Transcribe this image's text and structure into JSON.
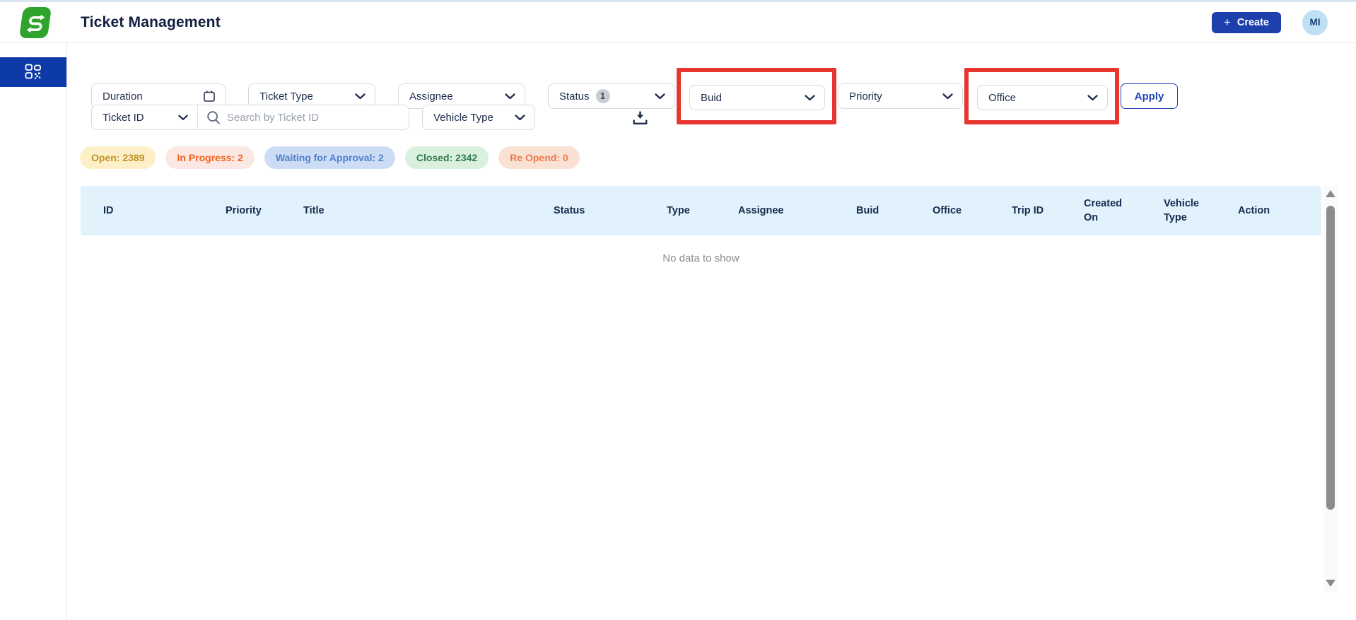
{
  "app": {
    "title": "Ticket Management",
    "create_button_label": "Create",
    "create_button_plus": "+",
    "avatar_initials": "MI"
  },
  "colors": {
    "brand_green": "#2fa42c",
    "primary_blue": "#1d40ad",
    "sidebar_active_blue": "#0d3aa6",
    "avatar_bg": "#bfdff2",
    "highlight_red": "#e8352f",
    "table_header_bg": "#e2f2fc"
  },
  "filters": {
    "duration_placeholder": "Duration",
    "ticket_type_label": "Ticket Type",
    "assignee_label": "Assignee",
    "status_label": "Status",
    "status_badge_count": "1",
    "buid_label": "Buid",
    "priority_label": "Priority",
    "office_label": "Office",
    "apply_button": "Apply",
    "ticket_id_label": "Ticket ID",
    "search_placeholder": "Search by Ticket ID",
    "vehicle_type_label": "Vehicle Type"
  },
  "status_summary": [
    {
      "label": "Open: 2389",
      "bg": "#fdf0c8",
      "color": "#c19122"
    },
    {
      "label": "In Progress: 2",
      "bg": "#fce8e2",
      "color": "#f1611e"
    },
    {
      "label": "Waiting for Approval: 2",
      "bg": "#cddcf5",
      "color": "#4e7ecb"
    },
    {
      "label": "Closed: 2342",
      "bg": "#daf0de",
      "color": "#2f7a4a"
    },
    {
      "label": "Re Opend: 0",
      "bg": "#f9e1d4",
      "color": "#ee7a4f"
    }
  ],
  "table": {
    "columns": [
      "ID",
      "Priority",
      "Title",
      "Status",
      "Type",
      "Assignee",
      "Buid",
      "Office",
      "Trip ID",
      "Created On",
      "Vehicle Type",
      "Action"
    ],
    "empty_message": "No data to show"
  }
}
